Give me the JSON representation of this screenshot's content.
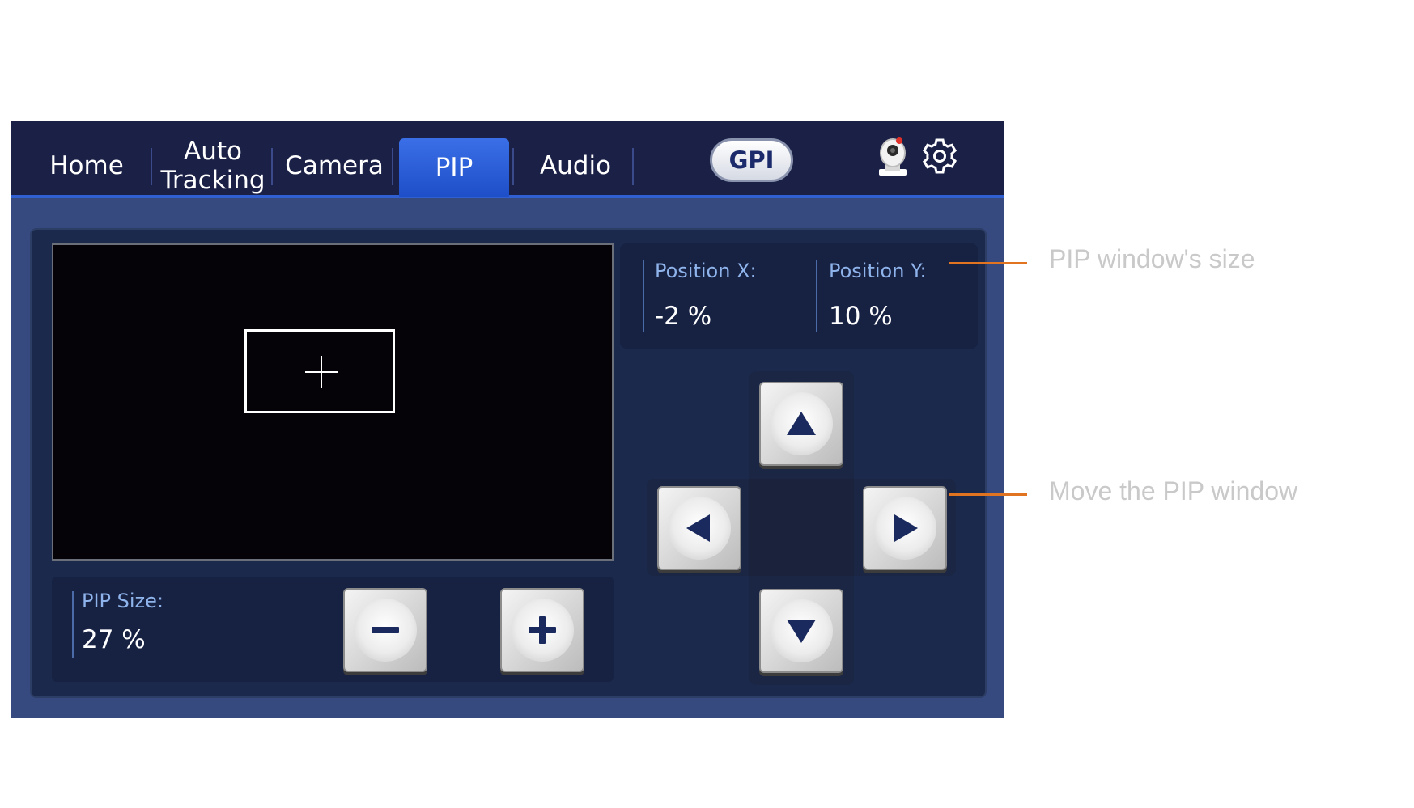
{
  "tabs": [
    {
      "label": "Home"
    },
    {
      "label": "Auto Tracking",
      "line1": "Auto",
      "line2": "Tracking"
    },
    {
      "label": "Camera"
    },
    {
      "label": "PIP",
      "active": true
    },
    {
      "label": "Audio"
    }
  ],
  "gpi_label": "GPI",
  "header_icons": [
    "ptz-camera-icon",
    "gear-icon"
  ],
  "position": {
    "x_label": "Position X:",
    "x_value": "-2 %",
    "y_label": "Position Y:",
    "y_value": "10 %"
  },
  "pip_size": {
    "label": "PIP Size:",
    "value": "27 %"
  },
  "dpad_icons": [
    "arrow-up-icon",
    "arrow-left-icon",
    "arrow-right-icon",
    "arrow-down-icon"
  ],
  "size_buttons": [
    "minus-icon",
    "plus-icon"
  ],
  "annotations": {
    "size_note": "PIP window's size",
    "move_note": "Move the PIP window"
  },
  "colors": {
    "active_tab": "#2a5fe0",
    "header_bg": "#1b2046",
    "panel_bg": "#364a80",
    "label_blue": "#8fb4ec",
    "leader_orange": "#e07420"
  }
}
